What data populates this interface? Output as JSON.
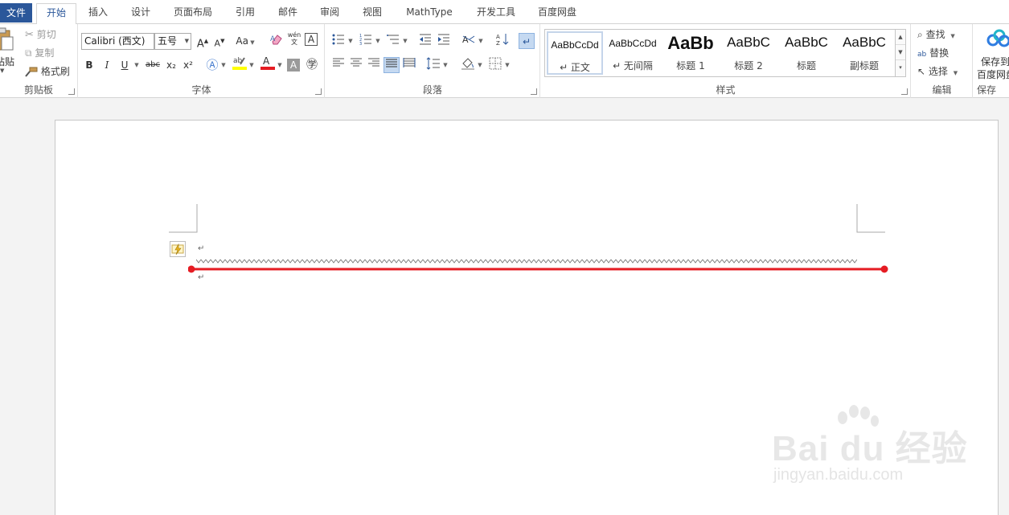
{
  "tabs": [
    {
      "label": "文件"
    },
    {
      "label": "开始"
    },
    {
      "label": "插入"
    },
    {
      "label": "设计"
    },
    {
      "label": "页面布局"
    },
    {
      "label": "引用"
    },
    {
      "label": "邮件"
    },
    {
      "label": "审阅"
    },
    {
      "label": "视图"
    },
    {
      "label": "MathType"
    },
    {
      "label": "开发工具"
    },
    {
      "label": "百度网盘"
    }
  ],
  "clipboard": {
    "group_label": "剪贴板",
    "paste": "粘贴",
    "cut": "剪切",
    "copy": "复制",
    "format_painter": "格式刷"
  },
  "font": {
    "group_label": "字体",
    "font_name": "Calibri (西文)",
    "font_size": "五号",
    "grow": "A",
    "shrink": "A",
    "case": "Aa",
    "bold": "B",
    "italic": "I",
    "underline": "U",
    "strike": "abc",
    "subscript": "x₂",
    "superscript": "x²",
    "phonetic": "wén\n文",
    "border_char": "A",
    "highlight_color": "#ffff00",
    "font_color": "#e51c23"
  },
  "paragraph": {
    "group_label": "段落"
  },
  "styles": {
    "group_label": "样式",
    "items": [
      {
        "sample": "AaBbCcDd",
        "name": "↵ 正文"
      },
      {
        "sample": "AaBbCcDd",
        "name": "↵ 无间隔"
      },
      {
        "sample": "AaBb",
        "name": "标题 1"
      },
      {
        "sample": "AaBbC",
        "name": "标题 2"
      },
      {
        "sample": "AaBbC",
        "name": "标题"
      },
      {
        "sample": "AaBbC",
        "name": "副标题"
      }
    ]
  },
  "editing": {
    "group_label": "编辑",
    "find": "查找",
    "replace": "替换",
    "select": "选择"
  },
  "save": {
    "group_label": "保存",
    "save_to": "保存到",
    "baidu": "百度网盘"
  },
  "document": {
    "para_mark": "↵",
    "highlight_line_color": "#e51c23"
  },
  "watermark": {
    "main": "Bai du 经验",
    "sub": "jingyan.baidu.com"
  }
}
